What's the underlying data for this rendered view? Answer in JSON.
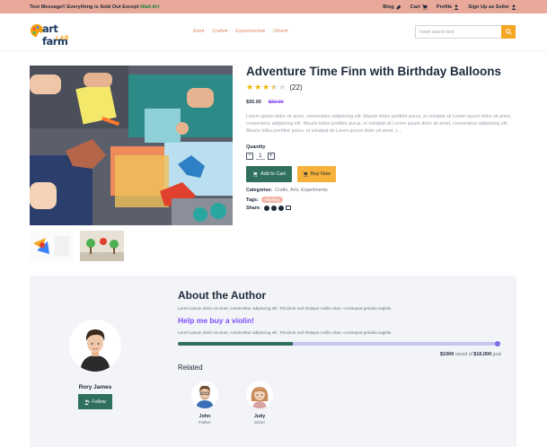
{
  "topbar": {
    "message": "Test Message!! Everything is Sold Out Except",
    "message_highlight": "Wall-Art",
    "links": {
      "blog": "Blog",
      "cart": "Cart",
      "profile": "Profile",
      "signup": "Sign Up as Seller"
    }
  },
  "header": {
    "logo_main": "art farm",
    "logo_sub": "LAB",
    "nav": [
      "Arts",
      "Crafts",
      "Experiments",
      "Other"
    ],
    "search_placeholder": "Insert search text"
  },
  "product": {
    "title": "Adventure Time Finn with Birthday Balloons",
    "rating": 3.5,
    "rating_count": "(22)",
    "price": "$30.00",
    "old_price": "$32.00",
    "description": "Lorem ipsum dolor sit amet, consectetur adipiscing elit. Mauris tellus porttitor purus, et volutpat sit Lorem ipsum dolor sit amet, consectetur adipiscing elit. Mauris tellus porttitor purus, et volutpat sit Lorem ipsum dolor sit amet, consectetur adipiscing elit. Mauris tellus porttitor purus, et volutpat sit Lorem ipsum dolor sit amet, c...",
    "quantity_label": "Quantity",
    "quantity": "1",
    "add_to_cart": "Add to Cart",
    "buy_now": "Buy Now",
    "categories_label": "Categories:",
    "categories": "Crafts, Arts, Experiments",
    "tags_label": "Tags:",
    "tag": "Painting",
    "share_label": "Share:"
  },
  "author": {
    "section_title": "About the Author",
    "about": "Lorem ipsum dolor sit amet, consectetur adipiscing elit. Tincidunt sed tristique mollis vitae, consequat gravida sagittis.",
    "name": "Rory James",
    "follow": "Follow",
    "help_title": "Help me buy a violin!",
    "help_text": "Lorem ipsum dolor sit amet, consectetur adipiscing elit. Tincidunt sed tristique mollis vitae, consequat gravida sagittis.",
    "raised": "$1000",
    "raised_mid": "raised of",
    "goal": "$10,000",
    "goal_suffix": "goal",
    "progress_fraction": 0.36,
    "related_title": "Related",
    "related": [
      {
        "name": "John",
        "role": "Father"
      },
      {
        "name": "Judy",
        "role": "Sister"
      }
    ]
  },
  "colors": {
    "topbar": "#e8a99a",
    "primary_green": "#2f6f5e",
    "accent_orange": "#f5b13a",
    "accent_purple": "#7c4dff"
  }
}
